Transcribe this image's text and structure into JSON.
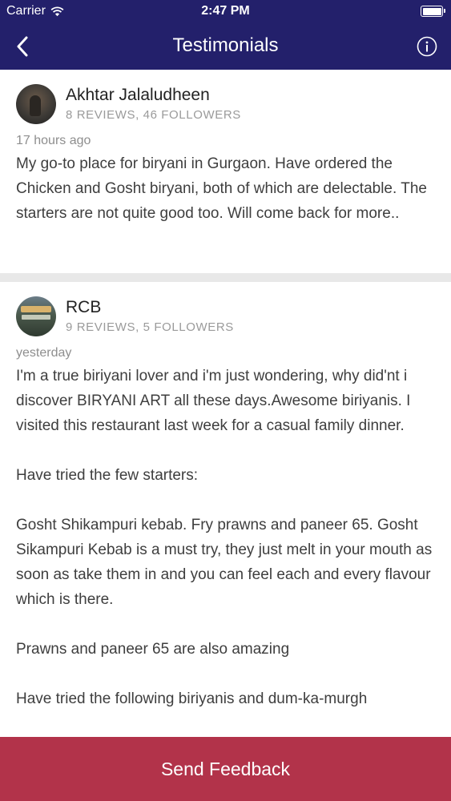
{
  "status_bar": {
    "carrier": "Carrier",
    "time": "2:47 PM"
  },
  "nav": {
    "title": "Testimonials",
    "back_icon": "chevron-left-icon",
    "info_icon": "info-circle-icon"
  },
  "reviews": [
    {
      "name": "Akhtar Jalaludheen",
      "stats": "8 REVIEWS, 46 FOLLOWERS",
      "time": "17 hours ago",
      "paragraphs": [
        "My go-to place for biryani in Gurgaon. Have ordered the Chicken and Gosht biryani, both of which are delectable. The starters are not quite good too. Will come back for more.."
      ]
    },
    {
      "name": "RCB",
      "stats": "9 REVIEWS, 5 FOLLOWERS",
      "time": "yesterday",
      "paragraphs": [
        "I'm a true biriyani lover and i'm just wondering, why did'nt i discover BIRYANI ART all these days.Awesome biriyanis. I visited this restaurant last week for a casual family dinner.",
        "Have tried the few starters:",
        "Gosht Shikampuri kebab. Fry prawns and paneer 65. Gosht Sikampuri Kebab is a must try, they just melt in your mouth as soon as take them in and you can feel each and every flavour which is there.",
        "Prawns and paneer 65 are also amazing",
        "Have tried the following biriyanis and dum-ka-murgh"
      ]
    }
  ],
  "footer": {
    "button_label": "Send Feedback"
  },
  "colors": {
    "nav_background": "#23206b",
    "button_background": "#b2334a"
  }
}
